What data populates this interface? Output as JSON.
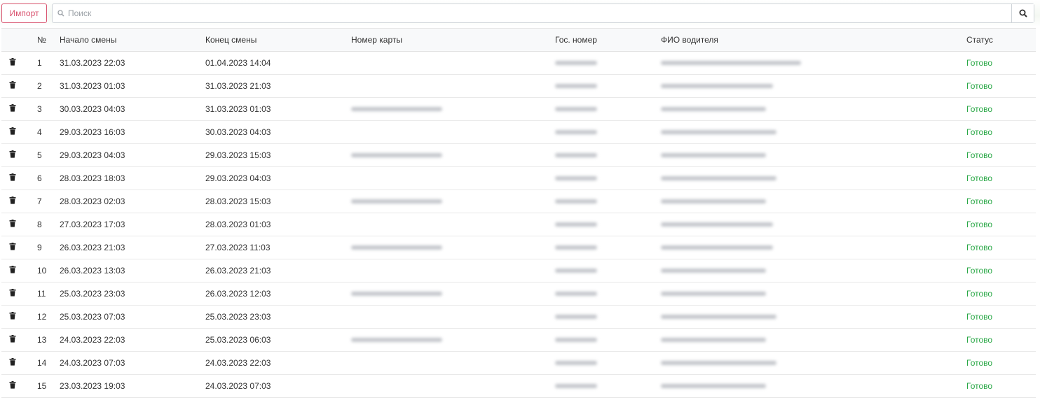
{
  "toolbar": {
    "import_label": "Импорт",
    "search_placeholder": "Поиск",
    "search_icon": "search-icon"
  },
  "table": {
    "columns": [
      "№",
      "Начало смены",
      "Конец смены",
      "Номер карты",
      "Гос. номер",
      "ФИО водителя",
      "Статус"
    ],
    "delete_icon": "trash-icon",
    "rows": [
      {
        "num": "1",
        "start": "31.03.2023 22:03",
        "end": "01.04.2023 14:04",
        "status": "Готово"
      },
      {
        "num": "2",
        "start": "31.03.2023 01:03",
        "end": "31.03.2023 21:03",
        "status": "Готово"
      },
      {
        "num": "3",
        "start": "30.03.2023 04:03",
        "end": "31.03.2023 01:03",
        "status": "Готово"
      },
      {
        "num": "4",
        "start": "29.03.2023 16:03",
        "end": "30.03.2023 04:03",
        "status": "Готово"
      },
      {
        "num": "5",
        "start": "29.03.2023 04:03",
        "end": "29.03.2023 15:03",
        "status": "Готово"
      },
      {
        "num": "6",
        "start": "28.03.2023 18:03",
        "end": "29.03.2023 04:03",
        "status": "Готово"
      },
      {
        "num": "7",
        "start": "28.03.2023 02:03",
        "end": "28.03.2023 15:03",
        "status": "Готово"
      },
      {
        "num": "8",
        "start": "27.03.2023 17:03",
        "end": "28.03.2023 01:03",
        "status": "Готово"
      },
      {
        "num": "9",
        "start": "26.03.2023 21:03",
        "end": "27.03.2023 11:03",
        "status": "Готово"
      },
      {
        "num": "10",
        "start": "26.03.2023 13:03",
        "end": "26.03.2023 21:03",
        "status": "Готово"
      },
      {
        "num": "11",
        "start": "25.03.2023 23:03",
        "end": "26.03.2023 12:03",
        "status": "Готово"
      },
      {
        "num": "12",
        "start": "25.03.2023 07:03",
        "end": "25.03.2023 23:03",
        "status": "Готово"
      },
      {
        "num": "13",
        "start": "24.03.2023 22:03",
        "end": "25.03.2023 06:03",
        "status": "Готово"
      },
      {
        "num": "14",
        "start": "24.03.2023 07:03",
        "end": "24.03.2023 22:03",
        "status": "Готово"
      },
      {
        "num": "15",
        "start": "23.03.2023 19:03",
        "end": "24.03.2023 07:03",
        "status": "Готово"
      }
    ]
  },
  "colors": {
    "import_accent": "#d9536f",
    "status_ok": "#28a745"
  }
}
